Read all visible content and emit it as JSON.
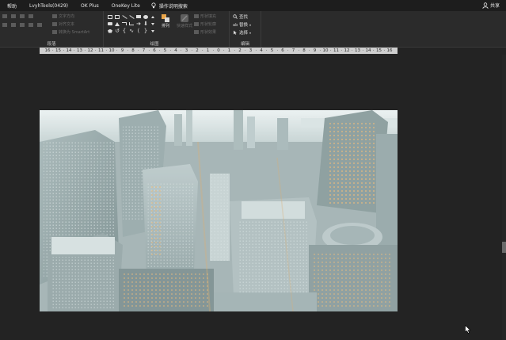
{
  "menu": {
    "items": [
      "帮助",
      "LvyhTools(0429)",
      "OK Plus",
      "OneKey Lite"
    ],
    "tell_me": "操作说明搜索",
    "share": "共享"
  },
  "ribbon": {
    "paragraph_label": "段落",
    "paragraph_cmds": [
      "文字方向",
      "对齐文本",
      "转换为 SmartArt"
    ],
    "drawing_label": "绘图",
    "arrange_label": "排列",
    "quick_styles_label": "快速样式",
    "format_cmds": [
      "形状填充",
      "形状轮廓",
      "形状效果"
    ],
    "editing_label": "编辑",
    "find_label": "查找",
    "replace_label": "替换",
    "select_label": "选择"
  },
  "ruler": {
    "ticks": [
      "16",
      "15",
      "14",
      "13",
      "12",
      "11",
      "10",
      "9",
      "8",
      "7",
      "6",
      "5",
      "4",
      "3",
      "2",
      "1",
      "0",
      "1",
      "2",
      "3",
      "4",
      "5",
      "6",
      "7",
      "8",
      "9",
      "10",
      "11",
      "12",
      "13",
      "14",
      "15",
      "16"
    ]
  },
  "colors": {
    "bg": "#232323",
    "ribbon": "#2b2b2b",
    "menubar": "#1d1d1d",
    "accent_orange": "#e8a54a"
  }
}
